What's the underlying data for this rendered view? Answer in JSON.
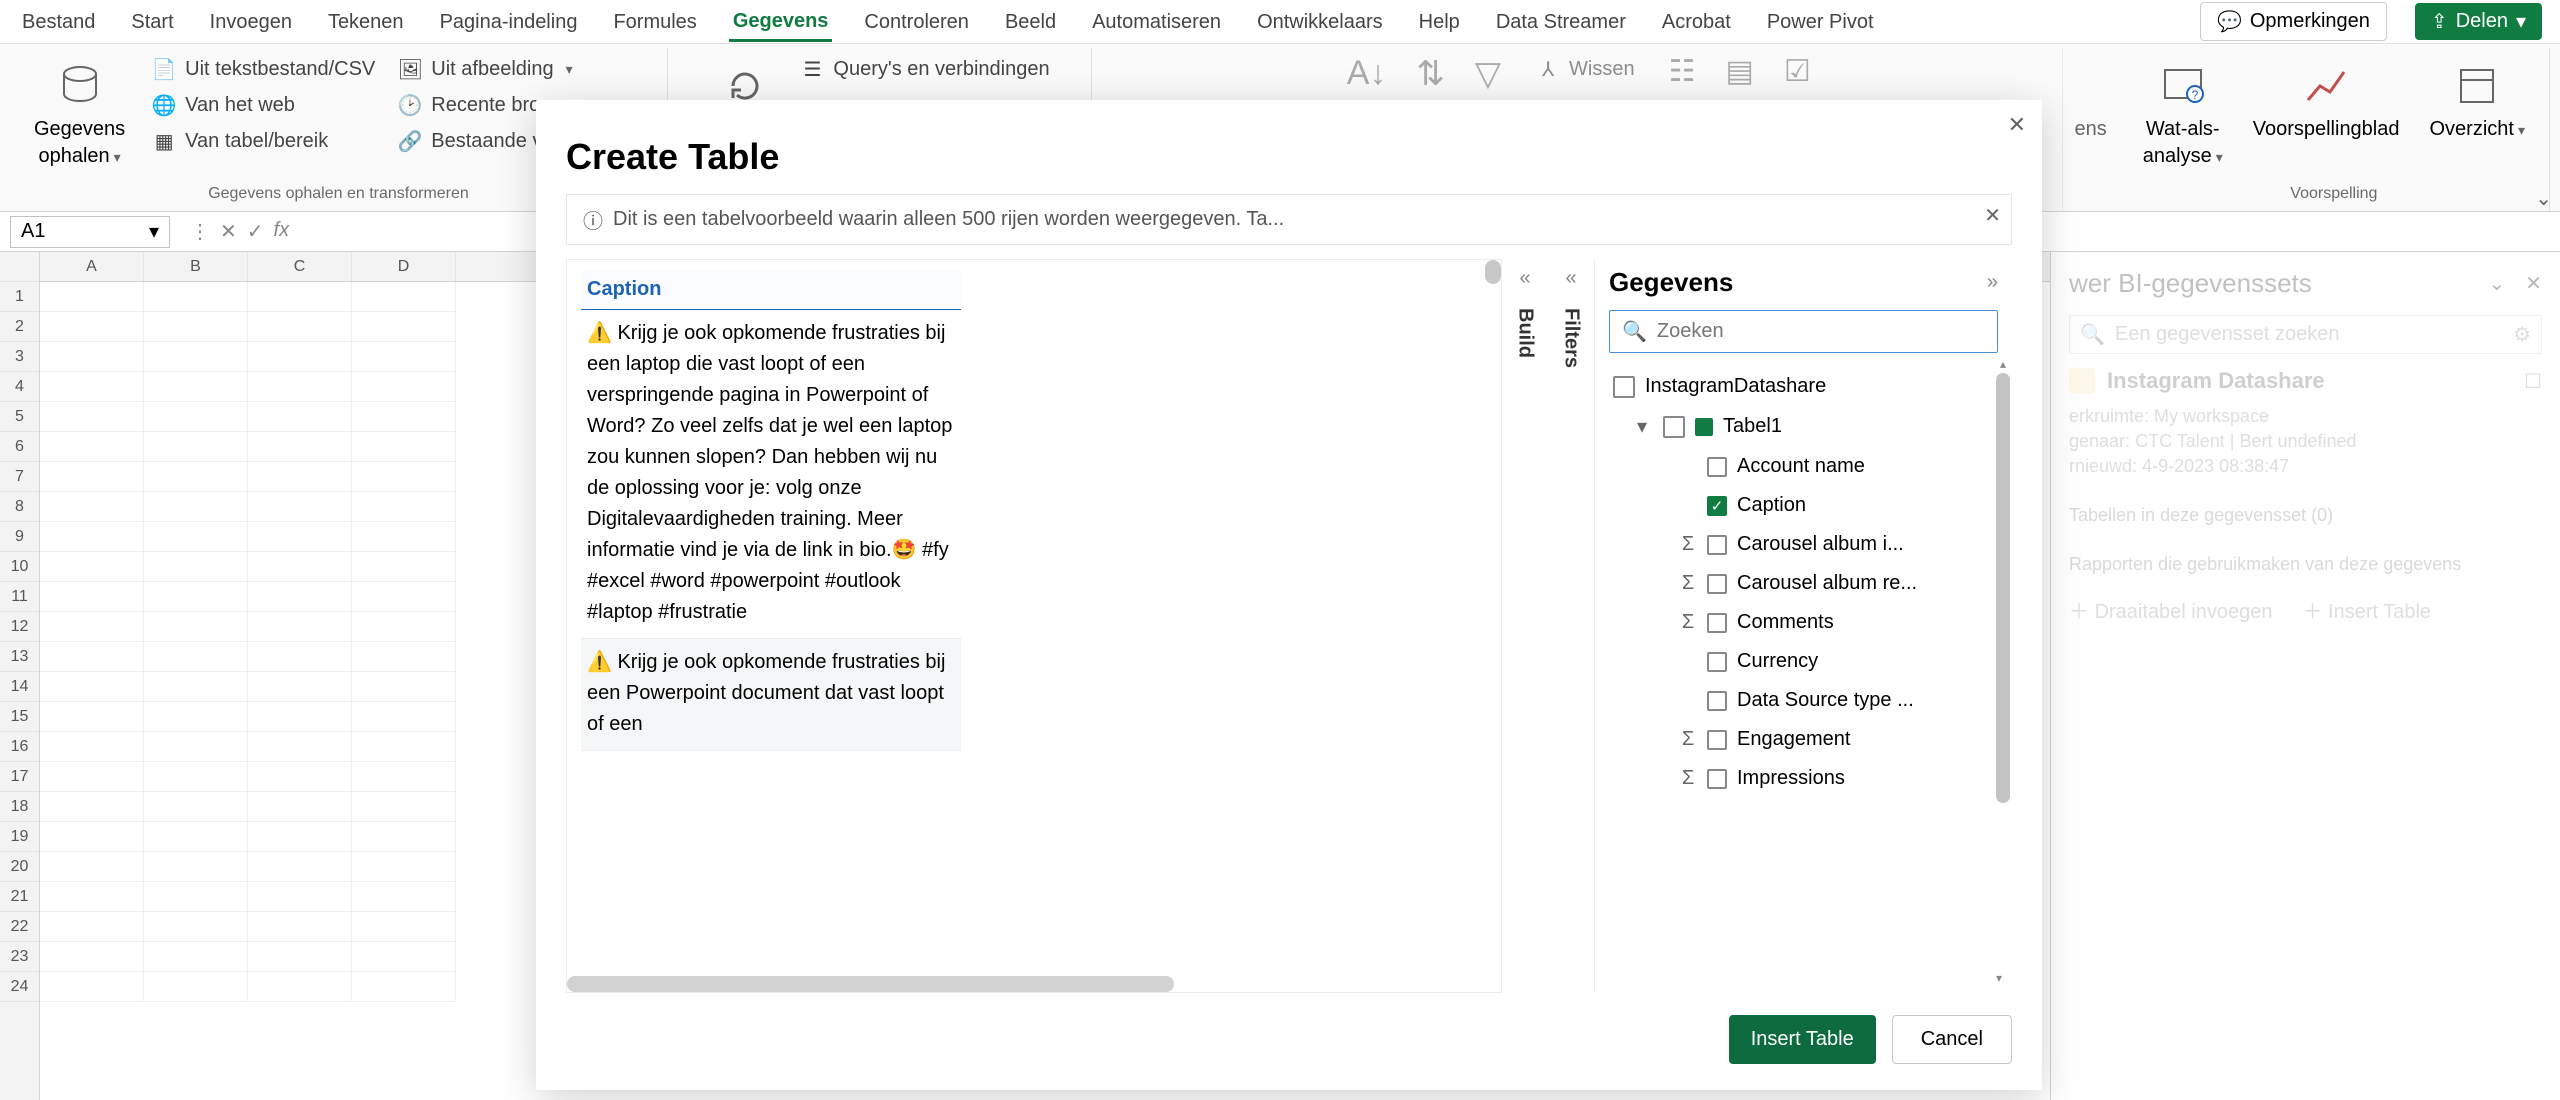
{
  "menubar": {
    "tabs": [
      "Bestand",
      "Start",
      "Invoegen",
      "Tekenen",
      "Pagina-indeling",
      "Formules",
      "Gegevens",
      "Controleren",
      "Beeld",
      "Automatiseren",
      "Ontwikkelaars",
      "Help",
      "Data Streamer",
      "Acrobat",
      "Power Pivot"
    ],
    "active_index": 6,
    "comments_label": "Opmerkingen",
    "share_label": "Delen"
  },
  "ribbon": {
    "group_getdata": {
      "big_label_line1": "Gegevens",
      "big_label_line2": "ophalen",
      "items": [
        "Uit tekstbestand/CSV",
        "Van het web",
        "Van tabel/bereik",
        "Uit afbeelding",
        "Recente bronnen",
        "Bestaande verbindingen"
      ],
      "group_label": "Gegevens ophalen en transformeren"
    },
    "queries_label": "Query's en verbindingen",
    "clear_label": "Wissen",
    "trailing_text": "ens",
    "group_forecast": {
      "whatif_line1": "Wat-als-",
      "whatif_line2": "analyse",
      "forecast_label": "Voorspellingblad",
      "overview_label": "Overzicht",
      "group_label": "Voorspelling"
    }
  },
  "formula_bar": {
    "cell_ref": "A1",
    "fx_label": "fx"
  },
  "grid": {
    "columns": [
      "A",
      "B",
      "C",
      "D"
    ],
    "rows": 24
  },
  "powerbi_pane": {
    "title_partial": "wer BI-gegevenssets",
    "search_placeholder": "Een gegevensset zoeken",
    "dataset_name": "Instagram Datashare",
    "meta": {
      "workspace_label": "erkruimte:",
      "workspace_value": "My workspace",
      "owner_label": "genaar:",
      "owner_value": "CTC Talent | Bert undefined",
      "refreshed_label": "rnieuwd:",
      "refreshed_value": "4-9-2023 08:38:47"
    },
    "tables_heading": "Tabellen in deze gegevensset (0)",
    "reports_heading": "Rapporten die gebruikmaken van deze gegevens",
    "insert_pivot": "Draaitabel invoegen",
    "insert_table": "Insert Table"
  },
  "dialog": {
    "title": "Create Table",
    "info_text": "Dit is een tabelvoorbeeld waarin alleen 500 rijen worden weergegeven. Ta...",
    "side_tabs": {
      "build": "Build",
      "filters": "Filters"
    },
    "fields": {
      "title": "Gegevens",
      "search_placeholder": "Zoeken",
      "dataset": "InstagramDatashare",
      "table": "Tabel1",
      "items": [
        {
          "name": "Account name",
          "checked": false,
          "sigma": false
        },
        {
          "name": "Caption",
          "checked": true,
          "sigma": false
        },
        {
          "name": "Carousel album i...",
          "checked": false,
          "sigma": true
        },
        {
          "name": "Carousel album re...",
          "checked": false,
          "sigma": true
        },
        {
          "name": "Comments",
          "checked": false,
          "sigma": true
        },
        {
          "name": "Currency",
          "checked": false,
          "sigma": false
        },
        {
          "name": "Data Source type ...",
          "checked": false,
          "sigma": false
        },
        {
          "name": "Engagement",
          "checked": false,
          "sigma": true
        },
        {
          "name": "Impressions",
          "checked": false,
          "sigma": true
        }
      ]
    },
    "preview": {
      "header": "Caption",
      "rows": [
        "⚠️ Krijg je ook opkomende frustraties bij een laptop die vast loopt of een verspringende pagina in Powerpoint of Word? Zo veel zelfs dat je wel een laptop zou kunnen slopen? Dan hebben wij nu de oplossing voor je: volg onze Digitalevaardigheden training. Meer informatie vind je via de link in bio.🤩 #fy #excel #word #powerpoint #outlook #laptop #frustratie",
        "⚠️ Krijg je ook opkomende frustraties bij een Powerpoint document dat vast loopt of een"
      ]
    },
    "footer": {
      "insert": "Insert Table",
      "cancel": "Cancel"
    }
  }
}
